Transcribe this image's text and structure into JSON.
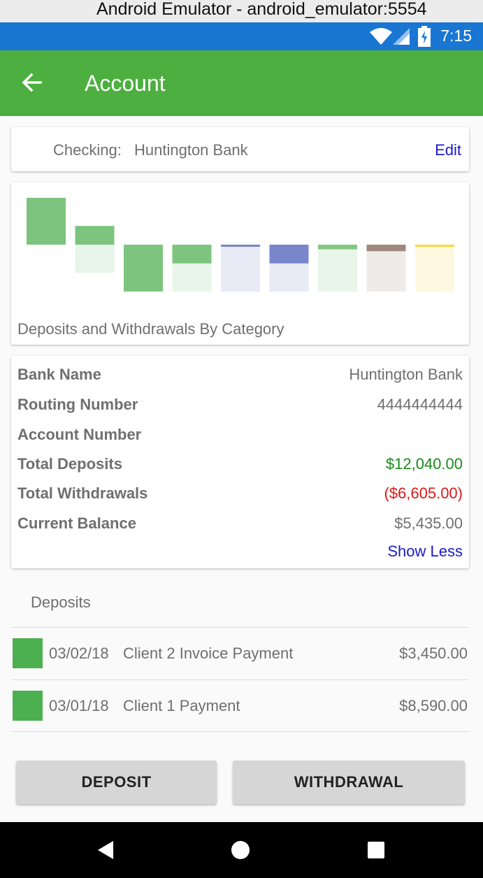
{
  "window": {
    "title": "Android Emulator - android_emulator:5554"
  },
  "status_bar": {
    "time": "7:15",
    "icons": [
      "wifi-icon",
      "cell-signal-icon",
      "battery-charging-icon"
    ]
  },
  "app_bar": {
    "title": "Account",
    "back_icon": "arrow-back-icon",
    "color": "#4caf3f"
  },
  "account": {
    "type_label": "Checking:",
    "bank": "Huntington Bank",
    "edit_label": "Edit"
  },
  "chart_data": {
    "type": "bar",
    "subtype": "waterfall-by-category",
    "title": "Deposits and Withdrawals By Category",
    "notes": "Floating bars; colored fill shows each category's contribution, pale fill shows remaining range.",
    "bars": [
      {
        "color": "#7dc47f",
        "pale": null,
        "fill_from": 0.0,
        "fill_to": 0.5,
        "pale_from": 0.0,
        "pale_to": 0.0
      },
      {
        "color": "#7dc47f",
        "pale": "#e8f5e9",
        "fill_from": 0.3,
        "fill_to": 0.5,
        "pale_from": 0.5,
        "pale_to": 0.8
      },
      {
        "color": "#7dc47f",
        "pale": null,
        "fill_from": 1.0,
        "fill_to": 0.5,
        "pale_from": 0.0,
        "pale_to": 0.0
      },
      {
        "color": "#7dc47f",
        "pale": "#e8f5e9",
        "fill_from": 0.5,
        "fill_to": 0.7,
        "pale_from": 0.7,
        "pale_to": 1.0
      },
      {
        "color": "#7986cb",
        "pale": "#e8eaf6",
        "fill_from": 0.5,
        "fill_to": 0.52,
        "pale_from": 0.52,
        "pale_to": 1.0
      },
      {
        "color": "#7986cb",
        "pale": "#e8eaf6",
        "fill_from": 0.5,
        "fill_to": 0.7,
        "pale_from": 0.7,
        "pale_to": 1.0
      },
      {
        "color": "#81c784",
        "pale": "#e8f5e9",
        "fill_from": 0.5,
        "fill_to": 0.55,
        "pale_from": 0.55,
        "pale_to": 1.0
      },
      {
        "color": "#a1887f",
        "pale": "#efebe9",
        "fill_from": 0.5,
        "fill_to": 0.57,
        "pale_from": 0.57,
        "pale_to": 1.0
      },
      {
        "color": "#fdd835",
        "pale": "#fff8e1",
        "fill_from": 0.5,
        "fill_to": 0.52,
        "pale_from": 0.52,
        "pale_to": 1.0
      }
    ]
  },
  "details": {
    "rows": [
      {
        "label": "Bank Name",
        "value": "Huntington Bank",
        "tone": ""
      },
      {
        "label": "Routing Number",
        "value": "4444444444",
        "tone": ""
      },
      {
        "label": "Account Number",
        "value": "",
        "tone": ""
      },
      {
        "label": "Total Deposits",
        "value": "$12,040.00",
        "tone": "green"
      },
      {
        "label": "Total Withdrawals",
        "value": "($6,605.00)",
        "tone": "red"
      },
      {
        "label": "Current Balance",
        "value": "$5,435.00",
        "tone": ""
      }
    ],
    "toggle_label": "Show Less"
  },
  "deposits": {
    "title": "Deposits",
    "items": [
      {
        "date": "03/02/18",
        "description": "Client 2 Invoice Payment",
        "amount": "$3,450.00",
        "color": "#4caf50"
      },
      {
        "date": "03/01/18",
        "description": "Client 1 Payment",
        "amount": "$8,590.00",
        "color": "#4caf50"
      }
    ]
  },
  "actions": {
    "deposit_label": "DEPOSIT",
    "withdrawal_label": "WITHDRAWAL"
  },
  "nav_bar": {
    "icons": [
      "back-triangle-icon",
      "home-circle-icon",
      "recents-square-icon"
    ]
  }
}
